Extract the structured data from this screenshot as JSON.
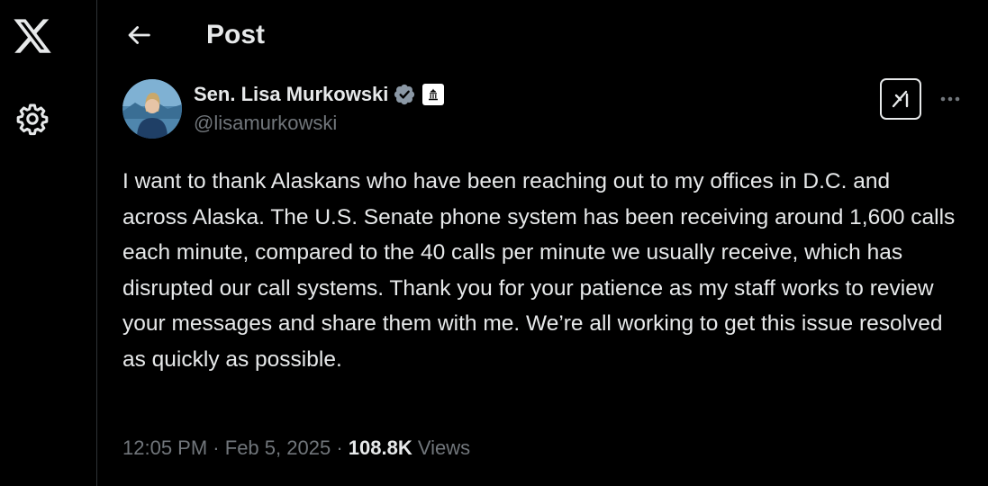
{
  "header": {
    "title": "Post"
  },
  "author": {
    "name": "Sen. Lisa Murkowski",
    "handle": "@lisamurkowski",
    "verified_badge_color": "#8b98a5"
  },
  "post": {
    "text": "I want to thank Alaskans who have been reaching out to my offices in D.C. and across Alaska. The U.S. Senate phone system has been receiving around 1,600 calls each minute, compared to the 40 calls per minute we usually receive, which has disrupted our call systems. Thank you for your patience as my staff works to review your messages and share them with me. We’re all working to get this issue resolved as quickly as possible.",
    "time": "12:05 PM",
    "separator": "·",
    "date": "Feb 5, 2025",
    "views_count": "108.8K",
    "views_label": "Views"
  },
  "colors": {
    "background": "#000000",
    "text": "#e7e9ea",
    "muted": "#71767b",
    "divider": "#2f3336"
  },
  "icons": [
    "x-logo-icon",
    "gear-icon",
    "back-arrow-icon",
    "verified-badge-icon",
    "government-building-icon",
    "grok-icon",
    "more-icon"
  ]
}
